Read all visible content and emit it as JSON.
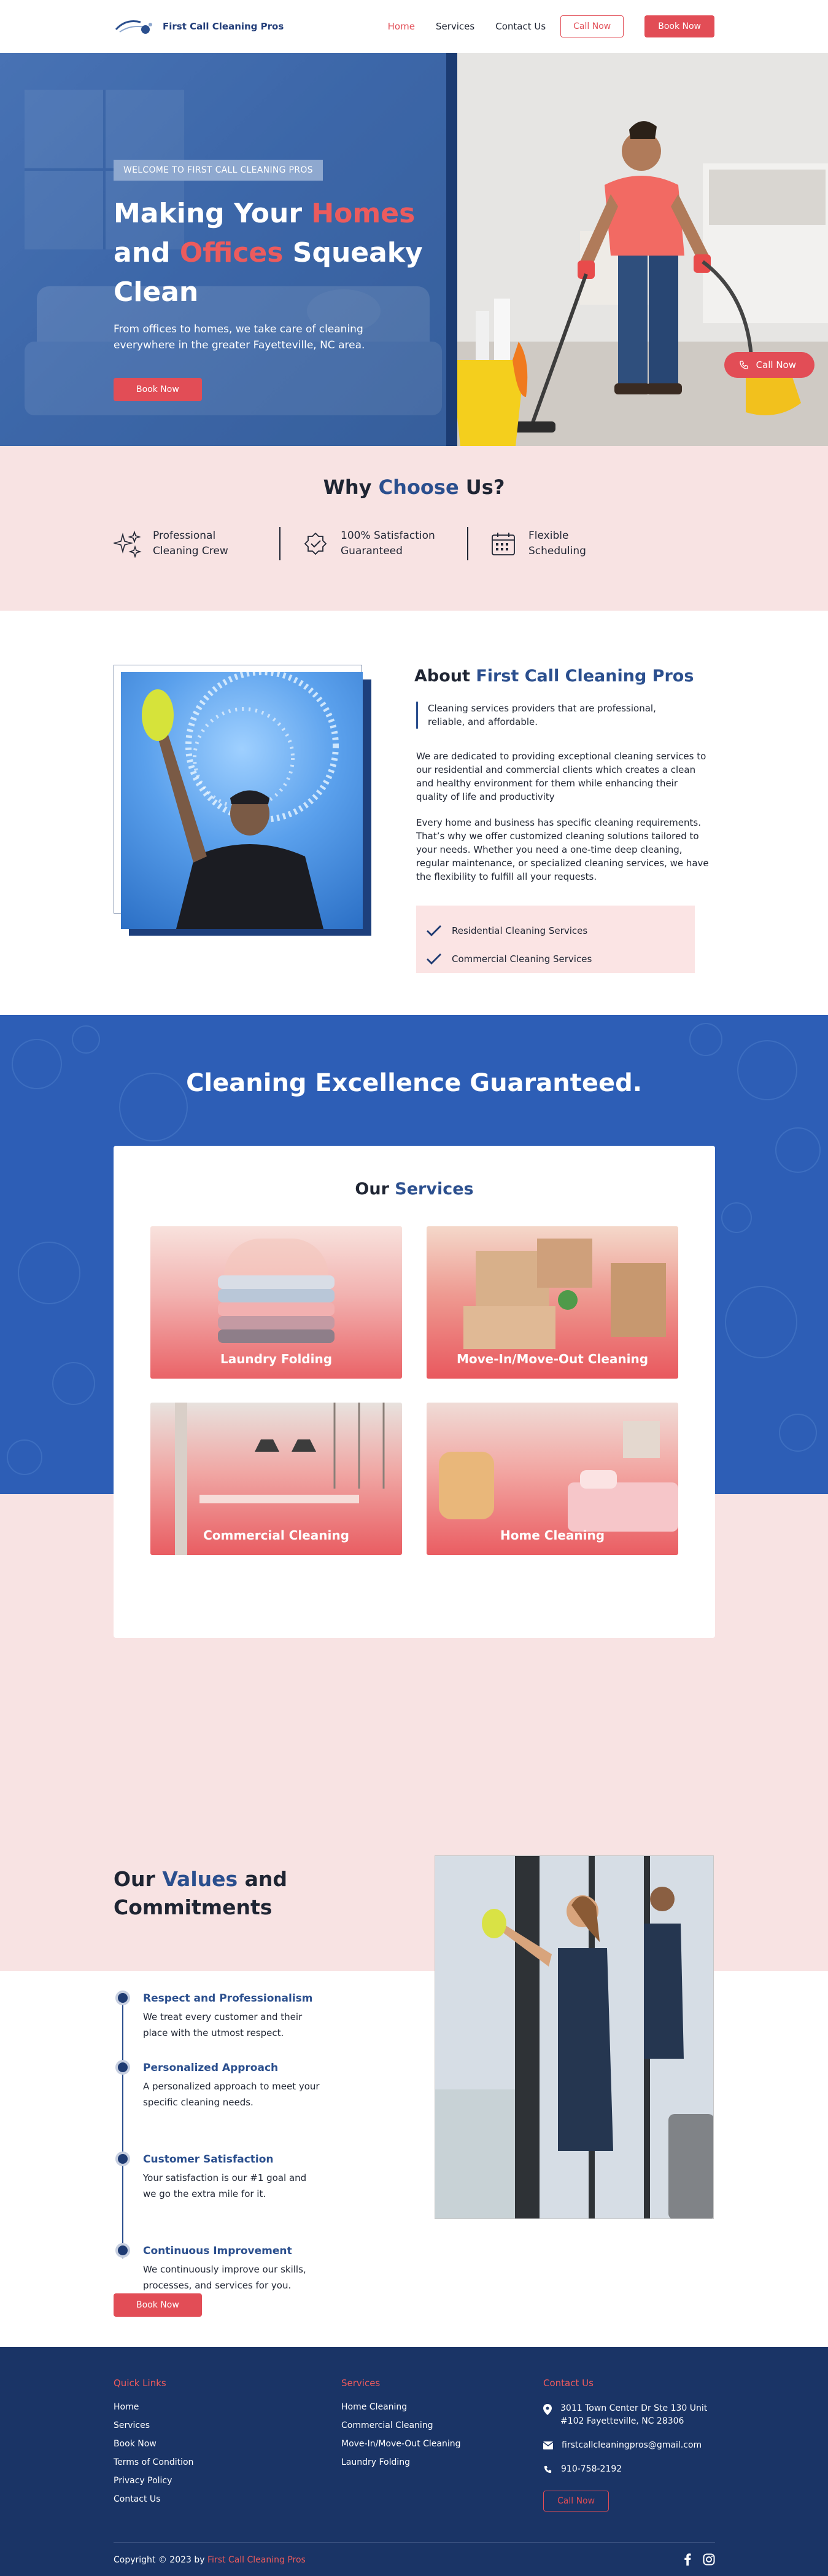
{
  "brand": {
    "name": "First Call Cleaning Pros"
  },
  "nav": {
    "items": [
      {
        "label": "Home",
        "active": true
      },
      {
        "label": "Services",
        "active": false
      },
      {
        "label": "Contact Us",
        "active": false
      }
    ],
    "call_label": "Call Now",
    "book_label": "Book Now"
  },
  "hero": {
    "badge": "WELCOME TO FIRST CALL CLEANING PROS",
    "title_parts": [
      "Making Your ",
      "Homes",
      " and ",
      "Offices",
      " Squeaky Clean"
    ],
    "subtitle": "From offices to homes, we take care of cleaning everywhere in the greater Fayetteville, NC area.",
    "book_label": "Book Now",
    "call_label": "Call Now"
  },
  "why": {
    "title_parts": [
      "Why ",
      "Choose",
      " Us?"
    ],
    "items": [
      {
        "icon": "sparkles-icon",
        "label": "Professional Cleaning Crew"
      },
      {
        "icon": "badge-check-icon",
        "label": "100% Satisfaction Guaranteed"
      },
      {
        "icon": "calendar-icon",
        "label": "Flexible Scheduling"
      }
    ]
  },
  "about": {
    "title_parts": [
      "About ",
      "First Call Cleaning Pros"
    ],
    "quote": "Cleaning services providers that are professional, reliable, and affordable.",
    "p1": "We are dedicated to providing exceptional cleaning services to our residential and commercial clients which creates a clean and healthy environment for them while enhancing their quality of life and productivity",
    "p2": "Every home and business has specific cleaning requirements. That’s why we offer customized cleaning solutions tailored to your needs. Whether you need a one-time deep cleaning, regular maintenance, or specialized cleaning services, we have the flexibility to fulfill all your requests.",
    "checks": [
      "Residential Cleaning Services",
      "Commercial Cleaning Services"
    ]
  },
  "excellence": {
    "title": "Cleaning Excellence Guaranteed."
  },
  "services": {
    "title_parts": [
      "Our ",
      "Services"
    ],
    "items": [
      "Laundry Folding",
      "Move-In/Move-Out Cleaning",
      "Commercial Cleaning",
      "Home Cleaning"
    ]
  },
  "values": {
    "title_parts": [
      "Our ",
      "Values",
      " and Commitments"
    ],
    "items": [
      {
        "title": "Respect and Professionalism",
        "desc": "We treat every customer and their place with the utmost respect."
      },
      {
        "title": "Personalized Approach",
        "desc": "A personalized approach to meet your specific cleaning needs."
      },
      {
        "title": "Customer Satisfaction",
        "desc": "Your satisfaction is our #1 goal and we go the extra mile for it."
      },
      {
        "title": "Continuous Improvement",
        "desc": "We continuously improve our skills, processes, and services for you."
      }
    ],
    "book_label": "Book Now"
  },
  "footer": {
    "quick_links_title": "Quick Links",
    "quick_links": [
      "Home",
      "Services",
      "Book Now",
      "Terms of Condition",
      "Privacy Policy",
      "Contact Us"
    ],
    "services_title": "Services",
    "services": [
      "Home Cleaning",
      "Commercial Cleaning",
      "Move-In/Move-Out Cleaning",
      "Laundry Folding"
    ],
    "contact_title": "Contact Us",
    "address_line1": "3011 Town Center Dr Ste 130 Unit",
    "address_line2": "#102 Fayetteville, NC 28306",
    "email": "firstcallcleaningpros@gmail.com",
    "phone": "910-758-2192",
    "call_label": "Call Now",
    "copyright_prefix": "Copyright © 2023 by ",
    "copyright_brand": "First Call Cleaning Pros",
    "social": [
      "facebook-icon",
      "instagram-icon"
    ]
  },
  "colors": {
    "accent": "#e24d56",
    "brand_blue": "#2b4f8e",
    "navy": "#1a3466",
    "pink_bg": "#f8e3e3"
  }
}
